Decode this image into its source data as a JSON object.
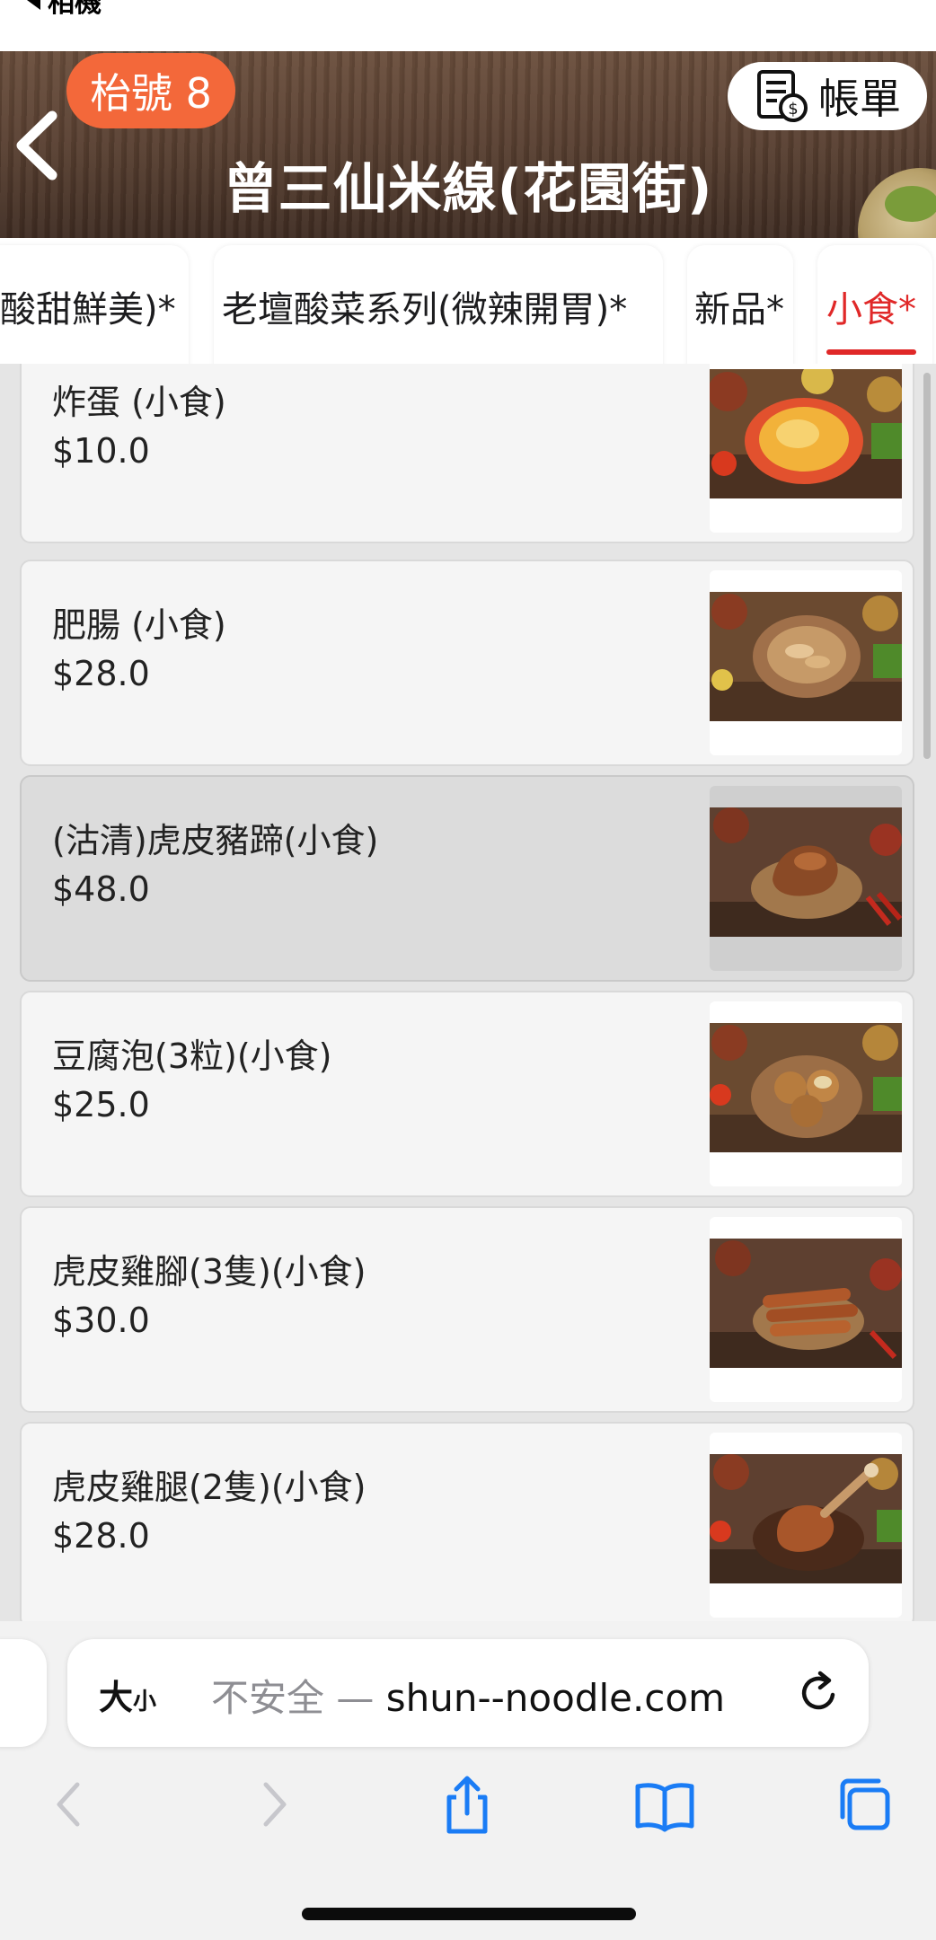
{
  "status": {
    "back_label": "相機"
  },
  "header": {
    "table_badge": "枱號 8",
    "bill_label": "帳單",
    "store_title": "曾三仙米線(花園街)"
  },
  "tabs": [
    {
      "label": "酸甜鮮美)*",
      "active": false
    },
    {
      "label": "老壇酸菜系列(微辣開胃)*",
      "active": false
    },
    {
      "label": "新品*",
      "active": false
    },
    {
      "label": "小食*",
      "active": true
    }
  ],
  "menu": {
    "items": [
      {
        "name": "炸蛋 (小食)",
        "price": "$10.0",
        "selected": false
      },
      {
        "name": "肥腸 (小食)",
        "price": "$28.0",
        "selected": false
      },
      {
        "name": "(沽清)虎皮豬蹄(小食)",
        "price": "$48.0",
        "selected": true
      },
      {
        "name": "豆腐泡(3粒)(小食)",
        "price": "$25.0",
        "selected": false
      },
      {
        "name": "虎皮雞腳(3隻)(小食)",
        "price": "$30.0",
        "selected": false
      },
      {
        "name": "虎皮雞腿(2隻)(小食)",
        "price": "$28.0",
        "selected": false
      }
    ]
  },
  "browser": {
    "text_size_label": "大",
    "text_size_small": "小",
    "not_secure": "不安全 —",
    "url": "shun--noodle.com"
  },
  "colors": {
    "accent": "#f3683a",
    "active_tab": "#e02828",
    "ios_blue": "#1a7cf5"
  }
}
